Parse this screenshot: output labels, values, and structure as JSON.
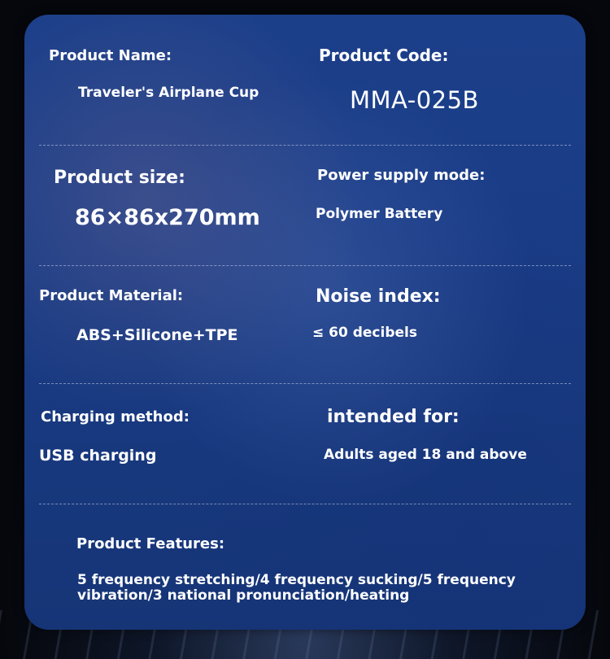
{
  "specs": {
    "product_name_label": "Product Name:",
    "product_name_value": "Traveler's Airplane Cup",
    "product_code_label": "Product Code:",
    "product_code_value": "MMA-025B",
    "size_label": "Product size:",
    "size_value": "86×86x270mm",
    "power_label": "Power supply mode:",
    "power_value": "Polymer Battery",
    "material_label": "Product Material:",
    "material_value": "ABS+Silicone+TPE",
    "noise_label": "Noise index:",
    "noise_value": "≤ 60 decibels",
    "charging_label": "Charging method:",
    "charging_value": "USB charging",
    "intended_label": "intended for:",
    "intended_value": "Adults aged 18 and above",
    "features_label": "Product Features:",
    "features_value": "5 frequency stretching/4 frequency sucking/5 frequency vibration/3 national pronunciation/heating"
  }
}
